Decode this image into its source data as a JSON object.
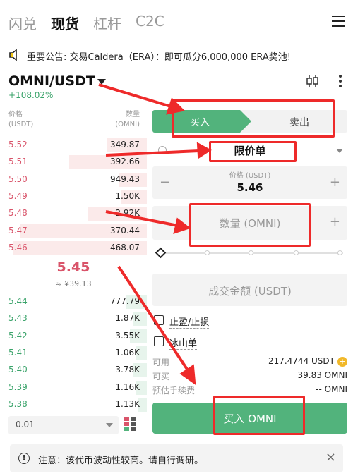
{
  "top_tabs": [
    "闪兑",
    "现货",
    "杠杆",
    "C2C"
  ],
  "active_tab": "现货",
  "announcement": "重要公告: 交易Caldera（ERA）：即可瓜分6,000,000 ERA奖池!",
  "pair": {
    "name": "OMNI/USDT",
    "change": "+108.02%"
  },
  "orderbook": {
    "price_header": [
      "价格",
      "(USDT)"
    ],
    "amount_header": [
      "数量",
      "(OMNI)"
    ],
    "asks": [
      {
        "price": "5.52",
        "amount": "349.87",
        "depth": 0.28
      },
      {
        "price": "5.51",
        "amount": "392.66",
        "depth": 0.55
      },
      {
        "price": "5.50",
        "amount": "949.43",
        "depth": 0.2
      },
      {
        "price": "5.49",
        "amount": "1.50K",
        "depth": 0.18
      },
      {
        "price": "5.48",
        "amount": "2.92K",
        "depth": 0.42
      },
      {
        "price": "5.47",
        "amount": "370.44",
        "depth": 0.9
      },
      {
        "price": "5.46",
        "amount": "468.07",
        "depth": 0.95
      }
    ],
    "mid_price": "5.45",
    "mid_cny": "≈ ¥39.13",
    "bids": [
      {
        "price": "5.44",
        "amount": "777.79",
        "depth": 0.15
      },
      {
        "price": "5.43",
        "amount": "1.87K",
        "depth": 0.1
      },
      {
        "price": "5.42",
        "amount": "3.55K",
        "depth": 0.12
      },
      {
        "price": "5.41",
        "amount": "1.06K",
        "depth": 0.08
      },
      {
        "price": "5.40",
        "amount": "3.78K",
        "depth": 0.1
      },
      {
        "price": "5.39",
        "amount": "1.16K",
        "depth": 0.08
      },
      {
        "price": "5.38",
        "amount": "1.13K",
        "depth": 0.06
      }
    ],
    "depth_step": "0.01"
  },
  "trade": {
    "buy_label": "买入",
    "sell_label": "卖出",
    "order_type": "限价单",
    "price_label": "价格 (USDT)",
    "price_value": "5.46",
    "qty_placeholder": "数量 (OMNI)",
    "amount_placeholder": "成交金额 (USDT)",
    "tp_sl": "止盈/止损",
    "iceberg": "冰山单",
    "available_label": "可用",
    "available_value": "217.4744 USDT",
    "can_buy_label": "可买",
    "can_buy_value": "39.83 OMNI",
    "fee_label": "预估手续费",
    "fee_value": "-- OMNI",
    "submit_label": "买入 OMNI"
  },
  "notice": "注意：该代币波动性较高。请自行调研。",
  "colors": {
    "buy": "#52b37c",
    "sell": "#d9546a",
    "annotation": "#ee2a2a"
  },
  "icons": [
    "menu-icon",
    "speaker-icon",
    "chevron-down-icon",
    "candlestick-icon",
    "more-icon",
    "info-icon",
    "layout-icon",
    "coin-icon",
    "close-icon"
  ]
}
